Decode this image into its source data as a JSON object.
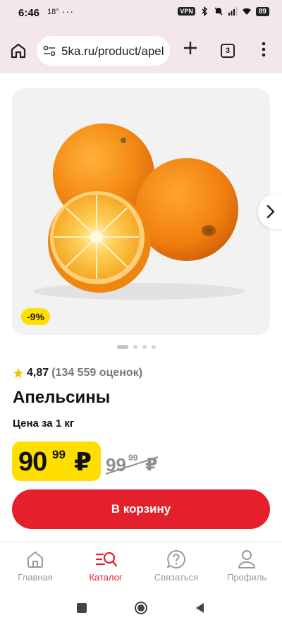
{
  "status_bar": {
    "time": "6:46",
    "temperature": "18°",
    "more": "···",
    "vpn": "VPN",
    "battery": "89"
  },
  "browser": {
    "url": "5ka.ru/product/apel",
    "tab_count": "3",
    "home_icon": "home-icon",
    "site_settings_icon": "tune-icon",
    "new_tab_icon": "plus-icon",
    "menu_icon": "more-vertical-icon"
  },
  "product": {
    "discount_badge": "-9%",
    "rating": "4,87",
    "rating_count": "(134 559 оценок)",
    "title": "Апельсины",
    "unit_label": "Цена за 1 кг",
    "price": {
      "main": "90",
      "cents": "99",
      "currency": "₽"
    },
    "old_price": {
      "main": "99",
      "cents": "99",
      "currency": "₽"
    },
    "add_to_cart": "В корзину",
    "gallery": {
      "total_images": 4,
      "active_index": 0
    }
  },
  "bottom_nav": {
    "items": [
      {
        "label": "Главная",
        "icon": "home-icon",
        "active": false
      },
      {
        "label": "Каталог",
        "icon": "catalog-search-icon",
        "active": true
      },
      {
        "label": "Связаться",
        "icon": "help-chat-icon",
        "active": false
      },
      {
        "label": "Профиль",
        "icon": "profile-icon",
        "active": false
      }
    ]
  },
  "colors": {
    "accent_red": "#e3202c",
    "price_yellow": "#ffdf00",
    "chrome_background": "#f3e7ea",
    "muted_text": "#9a9a9a"
  }
}
